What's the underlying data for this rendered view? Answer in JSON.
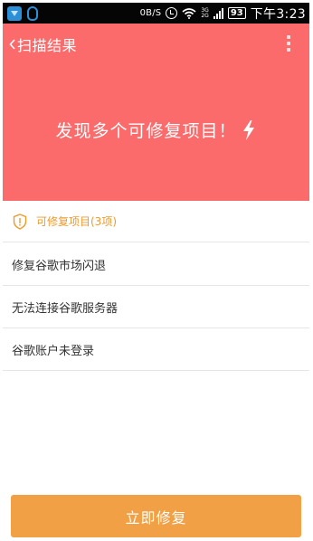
{
  "status_bar": {
    "net_speed": "0B/S",
    "net_tag_top": "3G",
    "net_tag_bottom": "2G",
    "battery": "93",
    "time": "下午3:23"
  },
  "header": {
    "title": "扫描结果",
    "headline": "发现多个可修复项目！",
    "background": "#fb6b6b"
  },
  "section": {
    "label": "可修复项目(3项)",
    "accent": "#ee9a2d"
  },
  "items": [
    {
      "label": "修复谷歌市场闪退"
    },
    {
      "label": "无法连接谷歌服务器"
    },
    {
      "label": "谷歌账户未登录"
    }
  ],
  "footer": {
    "button_label": "立即修复",
    "button_color": "#f1a045"
  },
  "icons": {
    "back": "chevron-left-icon",
    "menu": "more-vertical-icon",
    "bolt": "lightning-bolt-icon",
    "shield": "shield-warning-icon"
  }
}
